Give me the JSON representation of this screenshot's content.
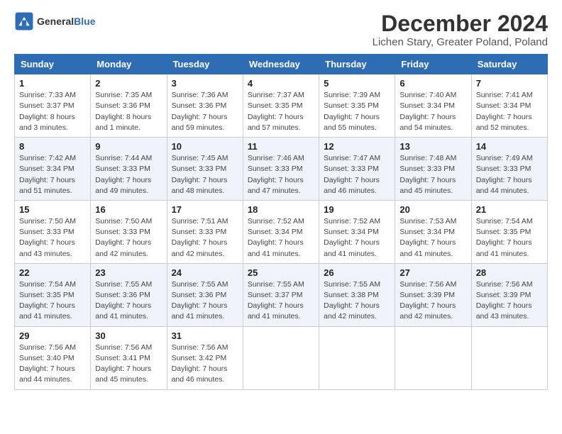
{
  "logo": {
    "line1": "General",
    "line2": "Blue"
  },
  "title": "December 2024",
  "subtitle": "Lichen Stary, Greater Poland, Poland",
  "headers": [
    "Sunday",
    "Monday",
    "Tuesday",
    "Wednesday",
    "Thursday",
    "Friday",
    "Saturday"
  ],
  "weeks": [
    [
      {
        "day": "1",
        "sunrise": "Sunrise: 7:33 AM",
        "sunset": "Sunset: 3:37 PM",
        "daylight": "Daylight: 8 hours and 3 minutes."
      },
      {
        "day": "2",
        "sunrise": "Sunrise: 7:35 AM",
        "sunset": "Sunset: 3:36 PM",
        "daylight": "Daylight: 8 hours and 1 minute."
      },
      {
        "day": "3",
        "sunrise": "Sunrise: 7:36 AM",
        "sunset": "Sunset: 3:36 PM",
        "daylight": "Daylight: 7 hours and 59 minutes."
      },
      {
        "day": "4",
        "sunrise": "Sunrise: 7:37 AM",
        "sunset": "Sunset: 3:35 PM",
        "daylight": "Daylight: 7 hours and 57 minutes."
      },
      {
        "day": "5",
        "sunrise": "Sunrise: 7:39 AM",
        "sunset": "Sunset: 3:35 PM",
        "daylight": "Daylight: 7 hours and 55 minutes."
      },
      {
        "day": "6",
        "sunrise": "Sunrise: 7:40 AM",
        "sunset": "Sunset: 3:34 PM",
        "daylight": "Daylight: 7 hours and 54 minutes."
      },
      {
        "day": "7",
        "sunrise": "Sunrise: 7:41 AM",
        "sunset": "Sunset: 3:34 PM",
        "daylight": "Daylight: 7 hours and 52 minutes."
      }
    ],
    [
      {
        "day": "8",
        "sunrise": "Sunrise: 7:42 AM",
        "sunset": "Sunset: 3:34 PM",
        "daylight": "Daylight: 7 hours and 51 minutes."
      },
      {
        "day": "9",
        "sunrise": "Sunrise: 7:44 AM",
        "sunset": "Sunset: 3:33 PM",
        "daylight": "Daylight: 7 hours and 49 minutes."
      },
      {
        "day": "10",
        "sunrise": "Sunrise: 7:45 AM",
        "sunset": "Sunset: 3:33 PM",
        "daylight": "Daylight: 7 hours and 48 minutes."
      },
      {
        "day": "11",
        "sunrise": "Sunrise: 7:46 AM",
        "sunset": "Sunset: 3:33 PM",
        "daylight": "Daylight: 7 hours and 47 minutes."
      },
      {
        "day": "12",
        "sunrise": "Sunrise: 7:47 AM",
        "sunset": "Sunset: 3:33 PM",
        "daylight": "Daylight: 7 hours and 46 minutes."
      },
      {
        "day": "13",
        "sunrise": "Sunrise: 7:48 AM",
        "sunset": "Sunset: 3:33 PM",
        "daylight": "Daylight: 7 hours and 45 minutes."
      },
      {
        "day": "14",
        "sunrise": "Sunrise: 7:49 AM",
        "sunset": "Sunset: 3:33 PM",
        "daylight": "Daylight: 7 hours and 44 minutes."
      }
    ],
    [
      {
        "day": "15",
        "sunrise": "Sunrise: 7:50 AM",
        "sunset": "Sunset: 3:33 PM",
        "daylight": "Daylight: 7 hours and 43 minutes."
      },
      {
        "day": "16",
        "sunrise": "Sunrise: 7:50 AM",
        "sunset": "Sunset: 3:33 PM",
        "daylight": "Daylight: 7 hours and 42 minutes."
      },
      {
        "day": "17",
        "sunrise": "Sunrise: 7:51 AM",
        "sunset": "Sunset: 3:33 PM",
        "daylight": "Daylight: 7 hours and 42 minutes."
      },
      {
        "day": "18",
        "sunrise": "Sunrise: 7:52 AM",
        "sunset": "Sunset: 3:34 PM",
        "daylight": "Daylight: 7 hours and 41 minutes."
      },
      {
        "day": "19",
        "sunrise": "Sunrise: 7:52 AM",
        "sunset": "Sunset: 3:34 PM",
        "daylight": "Daylight: 7 hours and 41 minutes."
      },
      {
        "day": "20",
        "sunrise": "Sunrise: 7:53 AM",
        "sunset": "Sunset: 3:34 PM",
        "daylight": "Daylight: 7 hours and 41 minutes."
      },
      {
        "day": "21",
        "sunrise": "Sunrise: 7:54 AM",
        "sunset": "Sunset: 3:35 PM",
        "daylight": "Daylight: 7 hours and 41 minutes."
      }
    ],
    [
      {
        "day": "22",
        "sunrise": "Sunrise: 7:54 AM",
        "sunset": "Sunset: 3:35 PM",
        "daylight": "Daylight: 7 hours and 41 minutes."
      },
      {
        "day": "23",
        "sunrise": "Sunrise: 7:55 AM",
        "sunset": "Sunset: 3:36 PM",
        "daylight": "Daylight: 7 hours and 41 minutes."
      },
      {
        "day": "24",
        "sunrise": "Sunrise: 7:55 AM",
        "sunset": "Sunset: 3:36 PM",
        "daylight": "Daylight: 7 hours and 41 minutes."
      },
      {
        "day": "25",
        "sunrise": "Sunrise: 7:55 AM",
        "sunset": "Sunset: 3:37 PM",
        "daylight": "Daylight: 7 hours and 41 minutes."
      },
      {
        "day": "26",
        "sunrise": "Sunrise: 7:55 AM",
        "sunset": "Sunset: 3:38 PM",
        "daylight": "Daylight: 7 hours and 42 minutes."
      },
      {
        "day": "27",
        "sunrise": "Sunrise: 7:56 AM",
        "sunset": "Sunset: 3:39 PM",
        "daylight": "Daylight: 7 hours and 42 minutes."
      },
      {
        "day": "28",
        "sunrise": "Sunrise: 7:56 AM",
        "sunset": "Sunset: 3:39 PM",
        "daylight": "Daylight: 7 hours and 43 minutes."
      }
    ],
    [
      {
        "day": "29",
        "sunrise": "Sunrise: 7:56 AM",
        "sunset": "Sunset: 3:40 PM",
        "daylight": "Daylight: 7 hours and 44 minutes."
      },
      {
        "day": "30",
        "sunrise": "Sunrise: 7:56 AM",
        "sunset": "Sunset: 3:41 PM",
        "daylight": "Daylight: 7 hours and 45 minutes."
      },
      {
        "day": "31",
        "sunrise": "Sunrise: 7:56 AM",
        "sunset": "Sunset: 3:42 PM",
        "daylight": "Daylight: 7 hours and 46 minutes."
      },
      null,
      null,
      null,
      null
    ]
  ]
}
